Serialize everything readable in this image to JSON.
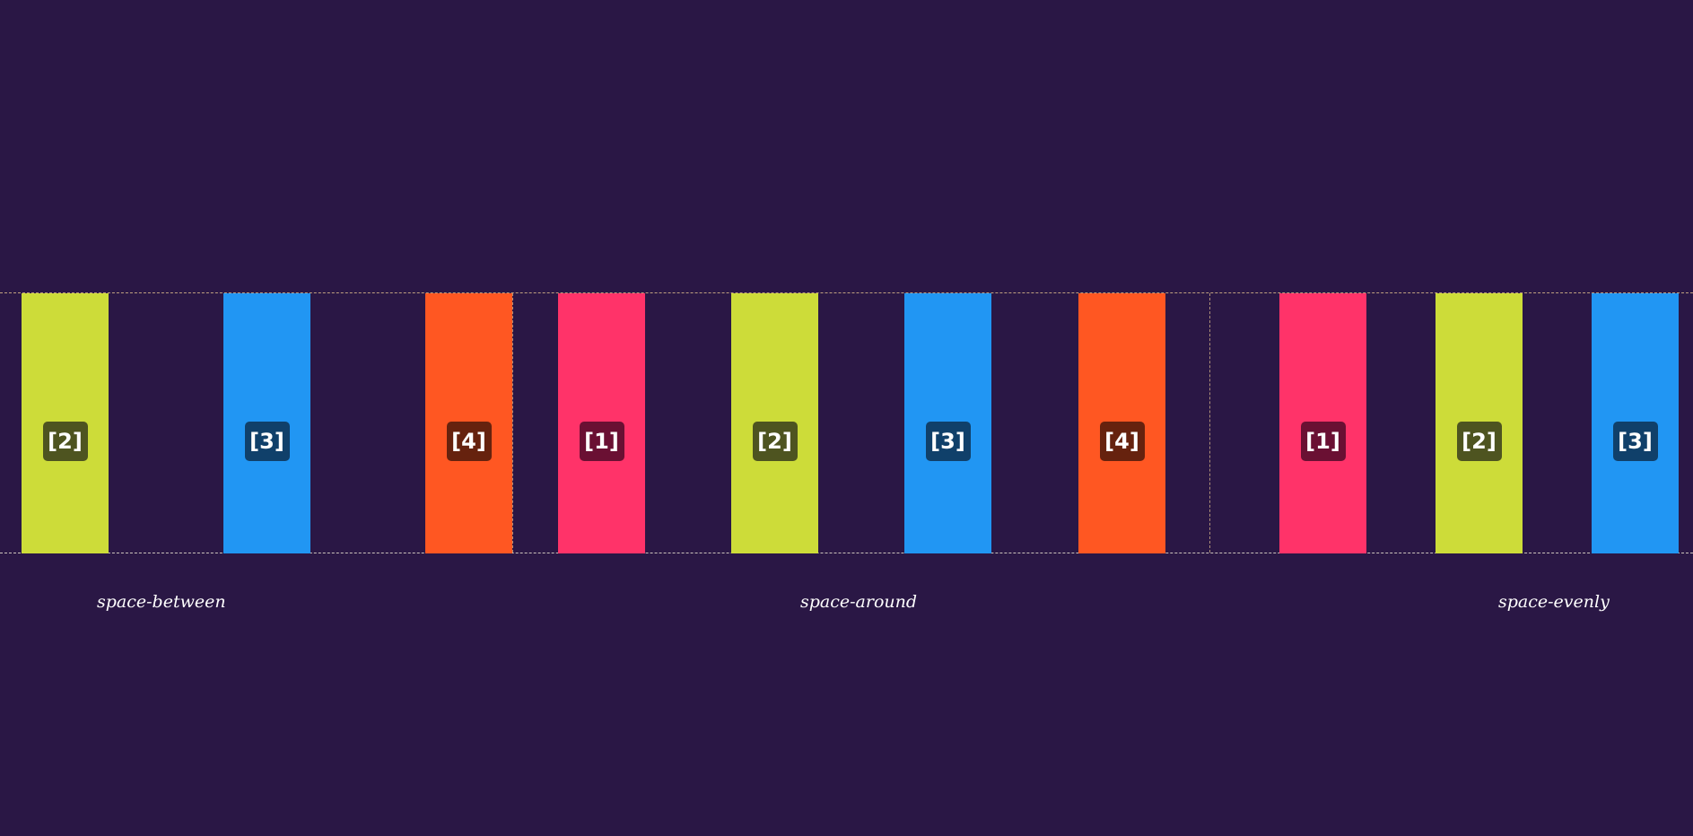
{
  "colors": {
    "background": "#2a1745",
    "lime": "#cddc39",
    "blue": "#2196f3",
    "orange": "#ff5722",
    "pink": "#ff3369",
    "lime_badge": "#4e5420",
    "blue_badge": "#10406a",
    "orange_badge": "#66220e",
    "pink_badge": "#6a1033",
    "divider": "#d9b98a"
  },
  "groups": [
    {
      "caption": "space-between",
      "items": [
        {
          "label": "[2]",
          "color": "lime"
        },
        {
          "label": "[3]",
          "color": "blue"
        },
        {
          "label": "[4]",
          "color": "orange"
        }
      ]
    },
    {
      "caption": "space-around",
      "items": [
        {
          "label": "[1]",
          "color": "pink"
        },
        {
          "label": "[2]",
          "color": "lime"
        },
        {
          "label": "[3]",
          "color": "blue"
        },
        {
          "label": "[4]",
          "color": "orange"
        }
      ]
    },
    {
      "caption": "space-evenly",
      "items": [
        {
          "label": "[1]",
          "color": "pink"
        },
        {
          "label": "[2]",
          "color": "lime"
        },
        {
          "label": "[3]",
          "color": "blue"
        }
      ]
    }
  ]
}
